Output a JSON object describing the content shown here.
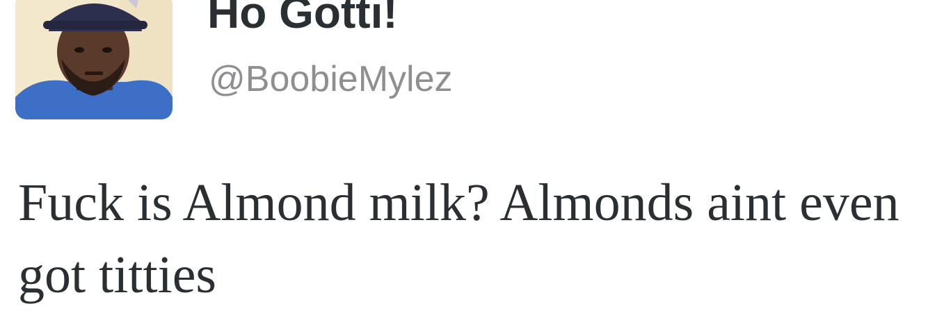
{
  "tweet": {
    "display_name": "Ho Gotti!",
    "handle": "@BoobieMylez",
    "text": "Fuck is Almond milk? Almonds aint even got titties",
    "avatar_icon": "profile-photo"
  },
  "colors": {
    "name": "#292f33",
    "handle": "#8d8f91",
    "text": "#292f33",
    "background": "#ffffff"
  }
}
